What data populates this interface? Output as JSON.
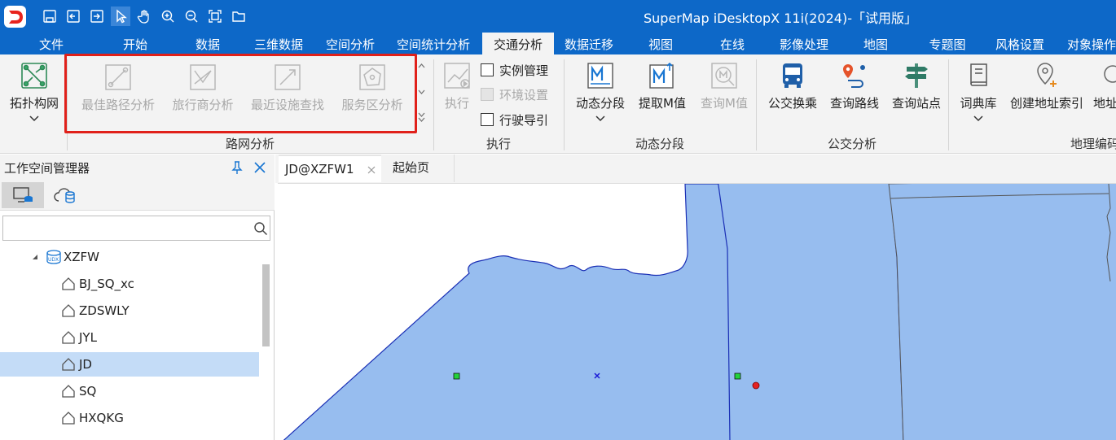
{
  "app": {
    "title": "SuperMap iDesktopX 11i(2024)-「试用版」"
  },
  "quick_access": [
    "save-icon",
    "open-icon",
    "import-icon",
    "select-cursor-icon",
    "pan-hand-icon",
    "zoom-in-icon",
    "zoom-out-icon",
    "full-extent-icon",
    "folder-icon"
  ],
  "ribbon_tabs": [
    "文件",
    "开始",
    "数据",
    "三维数据",
    "空间分析",
    "空间统计分析",
    "交通分析",
    "数据迁移",
    "视图",
    "在线",
    "影像处理",
    "地图",
    "专题图",
    "风格设置",
    "对象操作"
  ],
  "active_tab": "交通分析",
  "ribbon": {
    "topology": {
      "label": "拓扑构网"
    },
    "network_buttons": [
      "最佳路径分析",
      "旅行商分析",
      "最近设施查找",
      "服务区分析"
    ],
    "network_group": "路网分析",
    "execute": {
      "label": "执行",
      "group": "执行",
      "instance_mgmt": "实例管理",
      "env_settings": "环境设置",
      "driving_guide": "行驶导引"
    },
    "dynamic": {
      "segment": "动态分段",
      "extract_m": "提取M值",
      "query_m": "查询M值",
      "group": "动态分段"
    },
    "transit": {
      "transfer": "公交换乘",
      "query_route": "查询路线",
      "query_stop": "查询站点",
      "group": "公交分析"
    },
    "geocode": {
      "dictionary": "词典库",
      "create_index": "创建地址索引",
      "partial": "地址",
      "group": "地理编码"
    }
  },
  "workspace_panel": {
    "title": "工作空间管理器",
    "tree": {
      "datasource": "XZFW",
      "datasets": [
        "BJ_SQ_xc",
        "ZDSWLY",
        "JYL",
        "JD",
        "SQ",
        "HXQKG"
      ],
      "selected": "JD"
    }
  },
  "doc_tabs": [
    "JD@XZFW1",
    "起始页"
  ],
  "colors": {
    "title_bar": "#0d68c8",
    "polygon_fill": "#97bdef",
    "polygon_stroke": "#1a2fb5",
    "selection": "#c4dcf7",
    "highlight_box": "#e0201a"
  }
}
